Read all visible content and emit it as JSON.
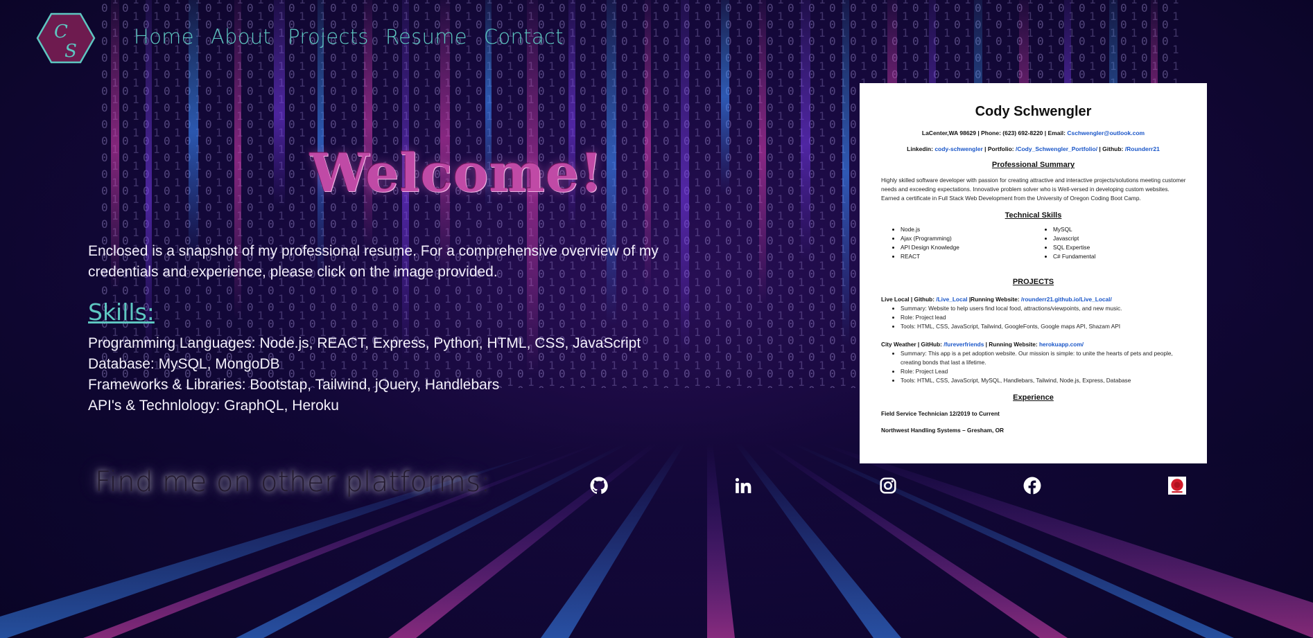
{
  "logo": {
    "letters": "CS",
    "fill": "#6e1b4f",
    "stroke": "#5ec7c1"
  },
  "nav": {
    "items": [
      {
        "label": "Home"
      },
      {
        "label": "About"
      },
      {
        "label": "Projects"
      },
      {
        "label": "Resume"
      },
      {
        "label": "Contact"
      }
    ],
    "color": "#5ec7c1"
  },
  "hero": {
    "title": "Welcome!",
    "intro": "Enclosed is a snapshot of my professional resume. For a comprehensive overview of my credentials and experience, please click on the image provided."
  },
  "skills": {
    "title": "Skills:",
    "lines": [
      "Programming Languages: Node.js, REACT, Express, Python, HTML, CSS, JavaScript",
      "Database: MySQL, MongoDB",
      "Frameworks & Libraries: Bootstap, Tailwind, jQuery, Handlebars",
      "API's & Technlology: GraphQL, Heroku"
    ]
  },
  "social": {
    "heading": "Find me on other platforms:",
    "icons": [
      "github-icon",
      "linkedin-icon",
      "instagram-icon",
      "facebook-icon",
      "badge-icon"
    ]
  },
  "resume": {
    "name": "Cody Schwengler",
    "contact_prefix": "LaCenter,WA 98629 | Phone: (623) 692-8220 | Email: ",
    "email": "Cschwengler@outlook.com",
    "linkedin_label": "Linkedin: ",
    "linkedin": "cody-schwengler",
    "portfolio_label": " | Portfolio: ",
    "portfolio": "/Cody_Schwengler_Portfolio/",
    "github_label": " | Github: ",
    "github": "/Rounderr21",
    "summary_heading": "Professional Summary",
    "summary": "Highly skilled software developer with passion for creating attractive and interactive projects/solutions meeting customer needs and exceeding expectations. Innovative problem solver who is Well-versed in developing custom websites. Earned a certificate in Full Stack Web Development from the University of Oregon Coding Boot Camp.",
    "skills_heading": "Technical Skills",
    "skills_left": [
      "Node.js",
      "Ajax (Programming)",
      "API Design Knowledge",
      "REACT"
    ],
    "skills_right": [
      "MySQL",
      "Javascript",
      "SQL Expertise",
      "C# Fundamental"
    ],
    "projects_heading": "PROJECTS",
    "project1": {
      "head_prefix": "Live Local | Github: ",
      "repo": "/Live_Local",
      "site_label": " |Running Website: ",
      "site": "/rounderr21.github.io/Live_Local/",
      "bullets": [
        "Summary: Website to help users find local food, attractions/viewpoints, and new music.",
        "Role: Project lead",
        "Tools: HTML, CSS, JavaScript, Tailwind, GoogleFonts, Google maps API, Shazam API"
      ]
    },
    "project2": {
      "head_prefix": "City Weather | GitHub: ",
      "repo": "/fureverfriends",
      "site_label": " | Running Website: ",
      "site": "herokuapp.com/",
      "bullets": [
        "Summary: This app is a pet adoption website. Our mission is simple: to unite the hearts of pets and people, creating bonds that last a lifetime.",
        "Role: Project Lead",
        "Tools: HTML, CSS, JavaScript, MySQL, Handlebars, Tailwind, Node.js, Express, Database"
      ]
    },
    "experience_heading": "Experience",
    "job_title": "Field Service Technician      12/2019 to Current",
    "employer": "Northwest Handling Systems – Gresham, OR"
  }
}
